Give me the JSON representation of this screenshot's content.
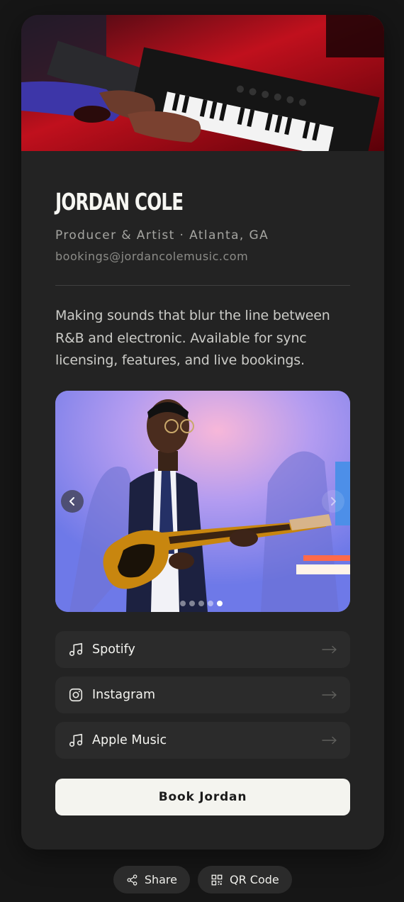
{
  "profile": {
    "name": "Jordan Cole",
    "role": "Producer & Artist · Atlanta, GA",
    "email": "bookings@jordancolemusic.com",
    "bio": "Making sounds that blur the line between R&B and electronic. Available for sync licensing, features, and live bookings."
  },
  "carousel": {
    "slide_count": 5,
    "active_index": 4,
    "prev_icon": "chevron-left-icon",
    "next_icon": "chevron-right-icon"
  },
  "links": [
    {
      "label": "Spotify",
      "icon": "music-note-icon"
    },
    {
      "label": "Instagram",
      "icon": "instagram-icon"
    },
    {
      "label": "Apple Music",
      "icon": "music-note-icon"
    }
  ],
  "cta": {
    "label": "Book Jordan"
  },
  "footer": {
    "share_label": "Share",
    "qr_label": "QR Code"
  },
  "colors": {
    "background": "#161616",
    "card": "#232323",
    "row": "#2b2b2b",
    "cta": "#f4f4ef"
  }
}
